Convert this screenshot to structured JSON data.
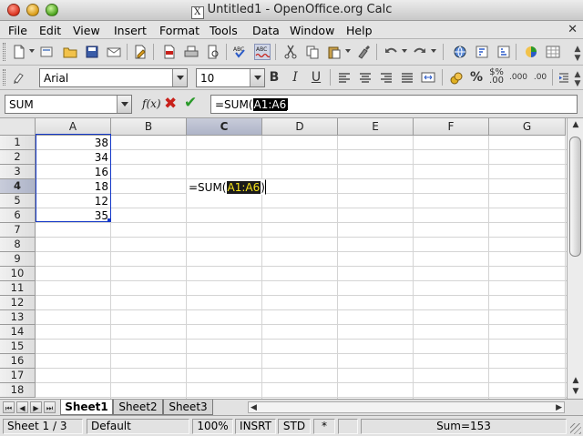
{
  "window": {
    "title": "Untitled1 - OpenOffice.org Calc",
    "app_icon": "X"
  },
  "menu": [
    "File",
    "Edit",
    "View",
    "Insert",
    "Format",
    "Tools",
    "Data",
    "Window",
    "Help"
  ],
  "formatting": {
    "font_name": "Arial",
    "font_size": "10"
  },
  "formula_bar": {
    "name_box": "SUM",
    "fx_label": "f(x)",
    "formula_prefix": "=SUM(",
    "formula_ref": "A1:A6"
  },
  "columns": [
    "A",
    "B",
    "C",
    "D",
    "E",
    "F",
    "G"
  ],
  "active_column": "C",
  "rows": [
    "1",
    "2",
    "3",
    "4",
    "5",
    "6",
    "7",
    "8",
    "9",
    "10",
    "11",
    "12",
    "13",
    "14",
    "15",
    "16",
    "17",
    "18"
  ],
  "active_row": "4",
  "cells": {
    "A1": "38",
    "A2": "34",
    "A3": "16",
    "A4": "18",
    "A5": "12",
    "A6": "35"
  },
  "edit_cell": {
    "ref": "C4",
    "prefix": "=SUM(",
    "range": "A1:A6",
    "suffix": ")"
  },
  "sheets": [
    "Sheet1",
    "Sheet2",
    "Sheet3"
  ],
  "active_sheet": "Sheet1",
  "status": {
    "sheet": "Sheet 1 / 3",
    "page_style": "Default",
    "zoom": "100%",
    "insert_mode": "INSRT",
    "selection_mode": "STD",
    "modified": "*",
    "sum": "Sum=153"
  },
  "colors": {
    "range_border": "#1438c8",
    "active_header": "#aeb4c8",
    "cancel": "#c8201a",
    "accept": "#2a9a2a"
  }
}
